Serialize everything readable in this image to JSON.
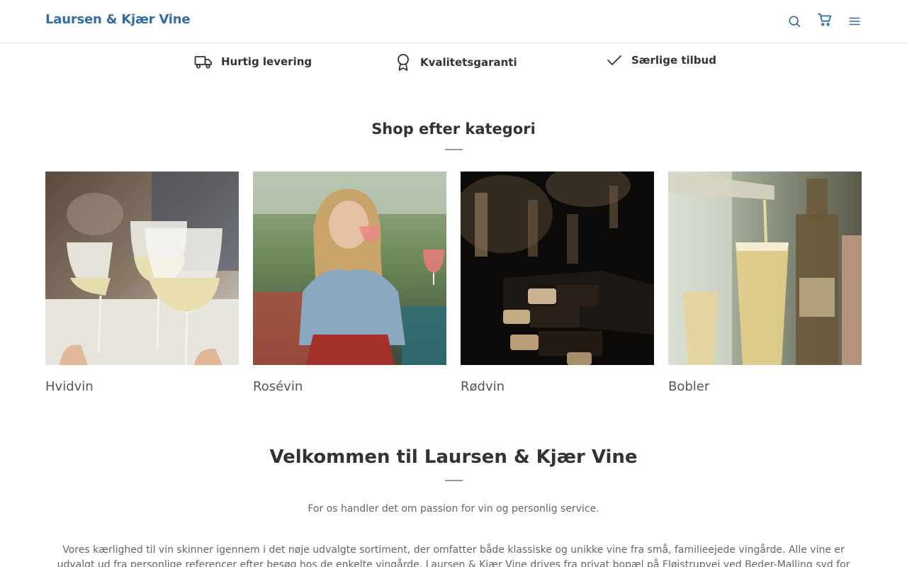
{
  "header": {
    "brand": "Laursen & Kjær Vine",
    "icons": [
      "search-icon",
      "cart-icon",
      "menu-icon"
    ],
    "accent_color": "#2e6da4"
  },
  "features": [
    {
      "icon": "truck-icon",
      "label": "Hurtig levering"
    },
    {
      "icon": "award-icon",
      "label": "Kvalitetsgaranti"
    },
    {
      "icon": "check-icon",
      "label": "Særlige tilbud"
    }
  ],
  "categories": {
    "title": "Shop efter kategori",
    "items": [
      {
        "label": "Hvidvin",
        "image": "white-wine-toast-photo"
      },
      {
        "label": "Rosévin",
        "image": "woman-drinking-rose-photo"
      },
      {
        "label": "Rødvin",
        "image": "red-wine-bottles-rack-photo"
      },
      {
        "label": "Bobler",
        "image": "champagne-pour-photo"
      }
    ]
  },
  "welcome": {
    "title": "Velkommen til Laursen & Kjær Vine",
    "tagline": "For os handler det om passion for vin og personlig service.",
    "body": "Vores kærlighed til vin skinner igennem i det nøje udvalgte sortiment, der omfatter både klassiske og unikke vine fra små, familieejede vingårde. Alle vine er udvalgt ud fra personlige referencer efter besøg hos de enkelte vingårde. Laursen & Kjær Vine drives fra privat bopæl på Fløjstrupvej ved Beder-Malling syd for Aarhus."
  }
}
